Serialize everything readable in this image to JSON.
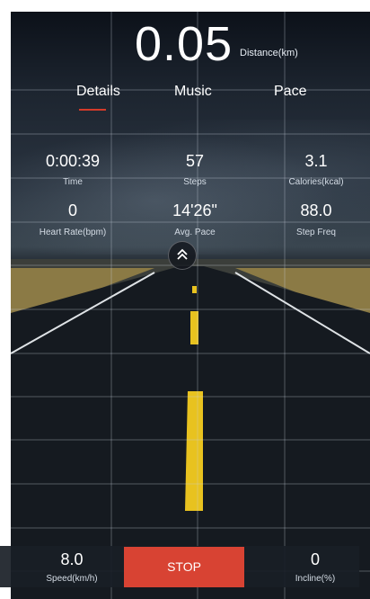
{
  "distance": {
    "value": "0.05",
    "label": "Distance(km)"
  },
  "tabs": [
    {
      "label": "Details"
    },
    {
      "label": "Music"
    },
    {
      "label": "Pace"
    }
  ],
  "stats": {
    "time": {
      "value": "0:00:39",
      "label": "Time"
    },
    "steps": {
      "value": "57",
      "label": "Steps"
    },
    "calories": {
      "value": "3.1",
      "label": "Calories(kcal)"
    },
    "heart_rate": {
      "value": "0",
      "label": "Heart Rate(bpm)"
    },
    "avg_pace": {
      "value": "14'26\"",
      "label": "Avg. Pace"
    },
    "step_freq": {
      "value": "88.0",
      "label": "Step Freq"
    }
  },
  "controls": {
    "collapse_icon": "double-chevron-up",
    "speed": {
      "value": "8.0",
      "label": "Speed(km/h)"
    },
    "stop_label": "STOP",
    "incline": {
      "value": "0",
      "label": "Incline(%)"
    }
  },
  "colors": {
    "accent": "#d84333",
    "tab_underline": "#d43a2a",
    "lane_line": "#e8c21f"
  }
}
